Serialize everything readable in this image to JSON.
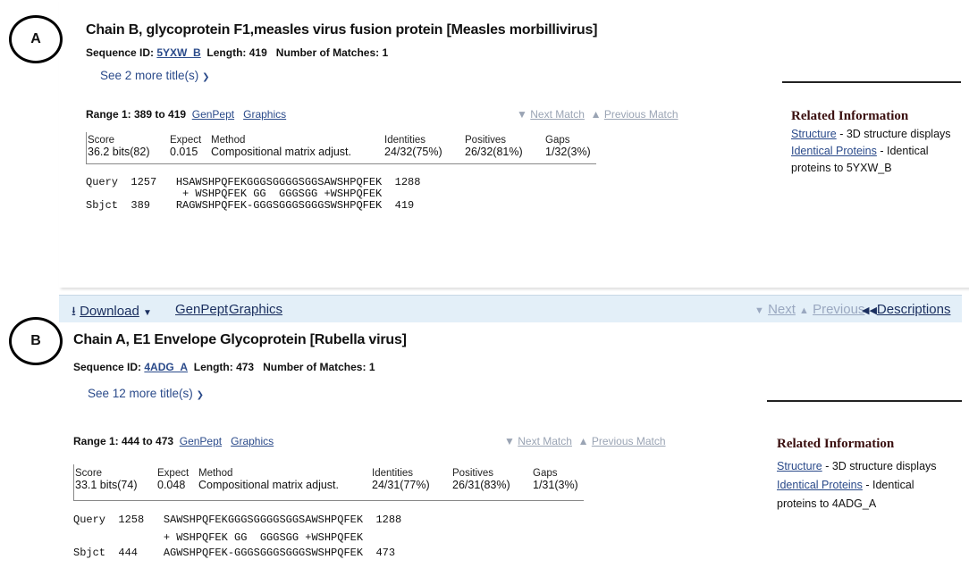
{
  "panels": [
    {
      "marker": "A",
      "title": "Chain B, glycoprotein F1,measles virus fusion protein [Measles morbillivirus]",
      "sequence_id_label": "Sequence ID:",
      "sequence_id": "5YXW_B",
      "length_label": "Length:",
      "length": "419",
      "matches_label": "Number of Matches:",
      "matches": "1",
      "see_more": "See 2 more title(s)",
      "range_label": "Range 1: 389 to 419",
      "genpept": "GenPept",
      "graphics": "Graphics",
      "next_match": "Next Match",
      "previous_match": "Previous Match",
      "stats_headers": [
        "Score",
        "Expect",
        "Method",
        "Identities",
        "Positives",
        "Gaps"
      ],
      "stats_values": [
        "36.2 bits(82)",
        "0.015",
        "Compositional matrix adjust.",
        "24/32(75%)",
        "26/32(81%)",
        "1/32(3%)"
      ],
      "alignment": {
        "query": "Query  1257   HSAWSHPQFEKGGGSGGGGSGGSAWSHPQFEK  1288",
        "midline": "               + WSHPQFEK GG  GGGSGG +WSHPQFEK",
        "sbjct": "Sbjct  389    RAGWSHPQFEK-GGGSGGGSGGGSWSHPQFEK  419"
      },
      "related": {
        "title": "Related Information",
        "structure_link": "Structure",
        "structure_text": " - 3D structure displays",
        "identical_link": "Identical Proteins",
        "identical_text": " - Identical",
        "identical_text2": "proteins to 5YXW_B"
      }
    },
    {
      "marker": "B",
      "title": "Chain A, E1 Envelope Glycoprotein [Rubella virus]",
      "sequence_id_label": "Sequence ID:",
      "sequence_id": "4ADG_A",
      "length_label": "Length:",
      "length": "473",
      "matches_label": "Number of Matches:",
      "matches": "1",
      "see_more": "See 12 more title(s)",
      "range_label": "Range 1: 444 to 473",
      "genpept": "GenPept",
      "graphics": "Graphics",
      "next_match": "Next Match",
      "previous_match": "Previous Match",
      "stats_headers": [
        "Score",
        "Expect",
        "Method",
        "Identities",
        "Positives",
        "Gaps"
      ],
      "stats_values": [
        "33.1 bits(74)",
        "0.048",
        "Compositional matrix adjust.",
        "24/31(77%)",
        "26/31(83%)",
        "1/31(3%)"
      ],
      "alignment": {
        "query": "Query  1258   SAWSHPQFEKGGGSGGGGSGGSAWSHPQFEK  1288",
        "midline": "              + WSHPQFEK GG  GGGSGG +WSHPQFEK",
        "sbjct": "Sbjct  444    AGWSHPQFEK-GGGSGGGSGGGSWSHPQFEK  473"
      },
      "related": {
        "title": "Related Information",
        "structure_link": "Structure",
        "structure_text": " - 3D structure displays",
        "identical_link": "Identical Proteins",
        "identical_text": " - Identical",
        "identical_text2": "proteins to 4ADG_A"
      }
    }
  ],
  "toolbar": {
    "download": "Download",
    "genpept": "GenPept",
    "graphics": "Graphics",
    "next": "Next",
    "previous": "Previous",
    "descriptions": "Descriptions"
  },
  "icons": {
    "download": "download-icon",
    "chevron": "chevron-down-icon",
    "next_arrow": "triangle-down-icon",
    "previous_arrow": "triangle-up-icon",
    "descriptions_arrow": "double-left-arrow-icon"
  },
  "colors": {
    "link": "#2a4a8a",
    "toolbar_bg": "#e3eff8",
    "related_title": "#3a0f0f",
    "dim": "#9aa4b4"
  }
}
